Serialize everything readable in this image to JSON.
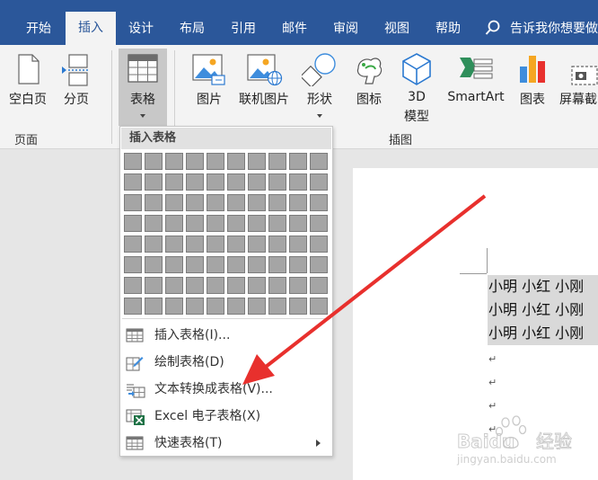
{
  "tabs": [
    "开始",
    "插入",
    "设计",
    "布局",
    "引用",
    "邮件",
    "审阅",
    "视图",
    "帮助"
  ],
  "active_tab": "插入",
  "tell_me": "告诉我你想要做",
  "ribbon": {
    "blank_page": "空白页",
    "page_break": "分页",
    "table": "表格",
    "pictures": "图片",
    "online_pictures": "联机图片",
    "shapes": "形状",
    "icons": "图标",
    "models_3d_line1": "3D",
    "models_3d_line2": "模型",
    "smartart": "SmartArt",
    "chart": "图表",
    "screenshot": "屏幕截",
    "group_pages": "页面",
    "group_illustrations": "插图"
  },
  "menu": {
    "header": "插入表格",
    "grid_cols": 10,
    "grid_rows": 8,
    "items": [
      {
        "label": "插入表格(I)...",
        "icon": "insert-table-icon",
        "submenu": false
      },
      {
        "label": "绘制表格(D)",
        "icon": "draw-table-icon",
        "submenu": false
      },
      {
        "label": "文本转换成表格(V)...",
        "icon": "text-to-table-icon",
        "submenu": false
      },
      {
        "label": "Excel 电子表格(X)",
        "icon": "excel-spreadsheet-icon",
        "submenu": false
      },
      {
        "label": "快速表格(T)",
        "icon": "quick-tables-icon",
        "submenu": true
      }
    ]
  },
  "document": {
    "rows": [
      "小明  小红  小刚",
      "小明  小红  小刚",
      "小明  小红  小刚"
    ],
    "paragraph_mark": "↵"
  },
  "watermark": {
    "brand": "Baidu经验",
    "url": "jingyan.baidu.com"
  },
  "colors": {
    "ribbon_blue": "#2b579a",
    "arrow_red": "#e8302d",
    "selection_gray": "#d9d9d9"
  }
}
